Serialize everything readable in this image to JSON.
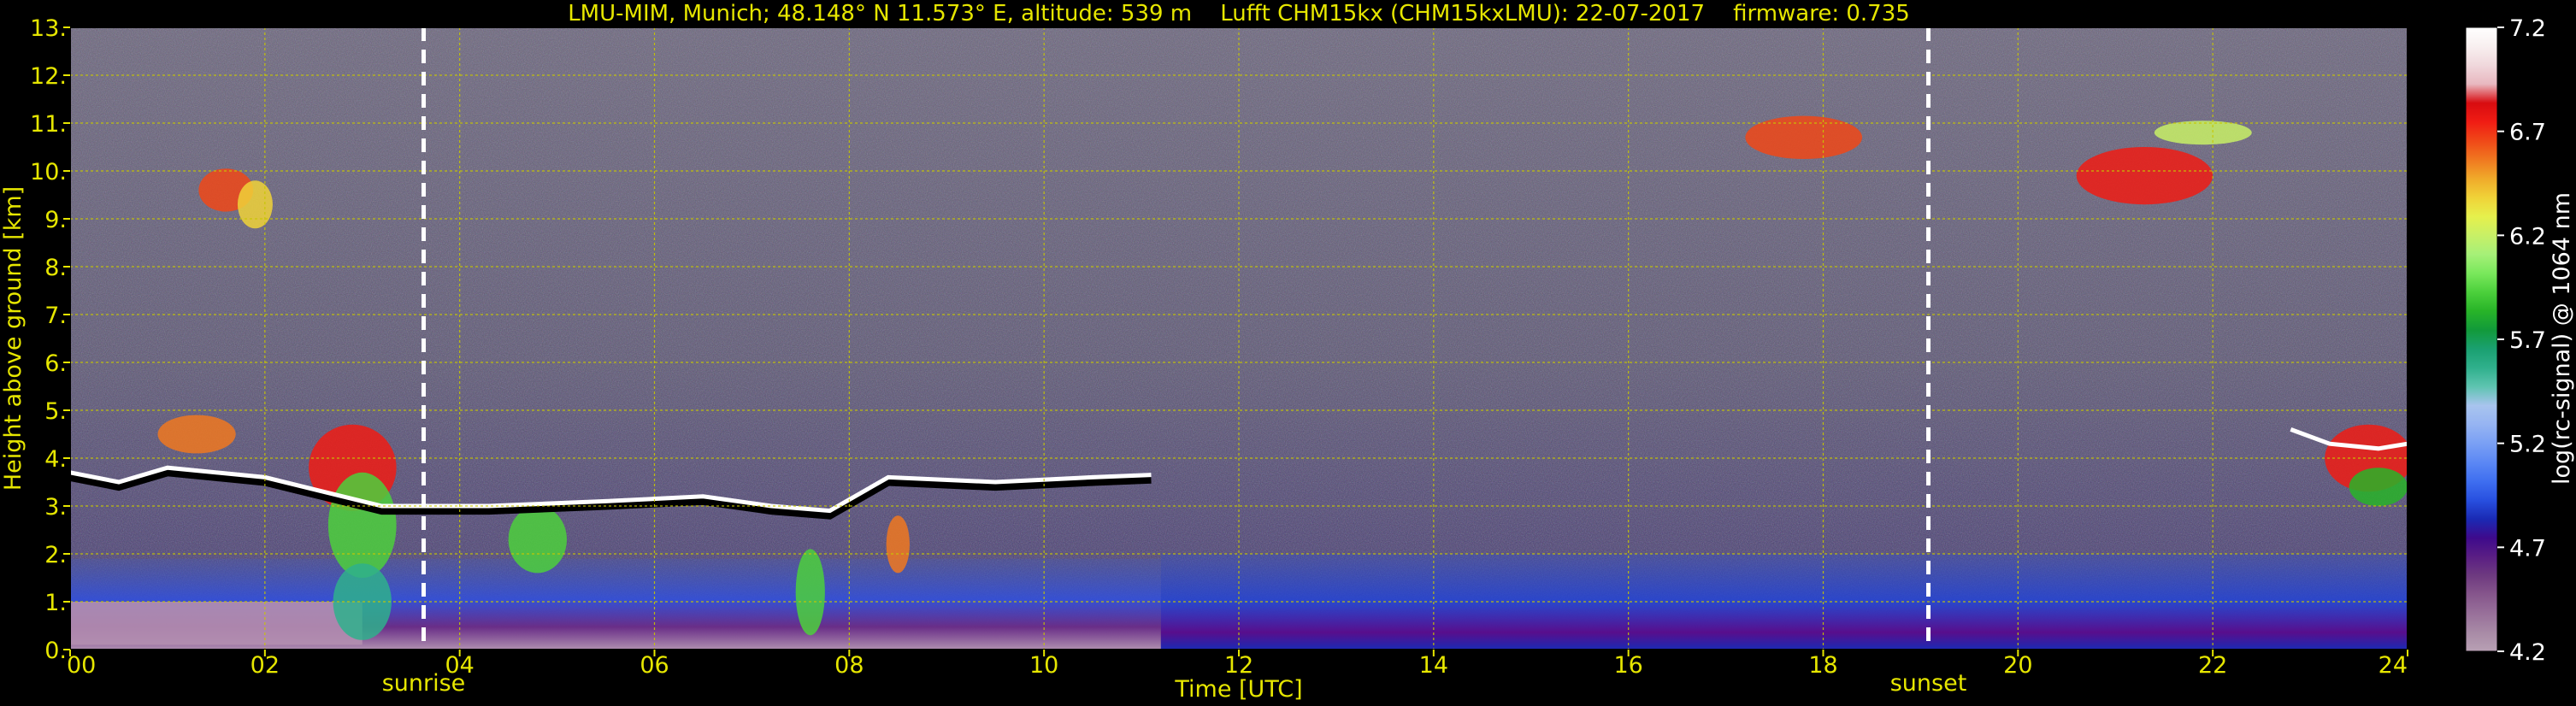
{
  "chart_data": {
    "type": "heatmap",
    "title": "LMU-MIM, Munich; 48.148° N 11.573° E, altitude: 539 m    Lufft CHM15kx (CHM15kxLMU): 22-07-2017    firmware: 0.735",
    "xlabel": "Time [UTC]",
    "ylabel": "Height above ground [km]",
    "xlim": [
      0,
      24
    ],
    "ylim": [
      0,
      13
    ],
    "x_ticks": [
      0,
      2,
      4,
      6,
      8,
      10,
      12,
      14,
      16,
      18,
      20,
      22,
      24
    ],
    "x_tick_labels": [
      "00",
      "02",
      "04",
      "06",
      "08",
      "10",
      "12",
      "14",
      "16",
      "18",
      "20",
      "22",
      "24"
    ],
    "y_ticks": [
      0,
      1,
      2,
      3,
      4,
      5,
      6,
      7,
      8,
      9,
      10,
      11,
      12,
      13
    ],
    "y_tick_labels": [
      "0.",
      "1.",
      "2.",
      "3.",
      "4.",
      "5.",
      "6.",
      "7.",
      "8.",
      "9.",
      "10.",
      "11.",
      "12.",
      "13."
    ],
    "grid": true,
    "grid_color": "#c8c800",
    "axis_text_color": "#e6e600",
    "background": "#000000",
    "annotations": [
      {
        "label": "sunrise",
        "x": 3.63
      },
      {
        "label": "sunset",
        "x": 19.08
      }
    ],
    "colorbar": {
      "label": "log(rc-signal) @ 1064 nm",
      "range": [
        4.2,
        7.2
      ],
      "tick_values": [
        4.2,
        4.7,
        5.2,
        5.7,
        6.2,
        6.7,
        7.2
      ],
      "tick_labels": [
        "4.2",
        "4.7",
        "5.2",
        "5.7",
        "6.2",
        "6.7",
        "7.2"
      ],
      "colors": [
        "#b8a0b4",
        "#a88aa6",
        "#98709a",
        "#86568c",
        "#6e3a80",
        "#5a1e84",
        "#3e0a8c",
        "#1a2ab4",
        "#2850e0",
        "#3f6ff0",
        "#5c88f4",
        "#7aa0f4",
        "#96b4f2",
        "#a8c4ee",
        "#5ec4b0",
        "#2fb08c",
        "#1aa070",
        "#129a3a",
        "#28b428",
        "#4cd03c",
        "#7ae85c",
        "#a6f078",
        "#c8f066",
        "#e6f04c",
        "#f0d238",
        "#f0aa2a",
        "#f07820",
        "#f04818",
        "#f01c14",
        "#d80c10",
        "#e8b8c0",
        "#f0d8dc",
        "#f8f0f0",
        "#ffffff"
      ]
    }
  }
}
